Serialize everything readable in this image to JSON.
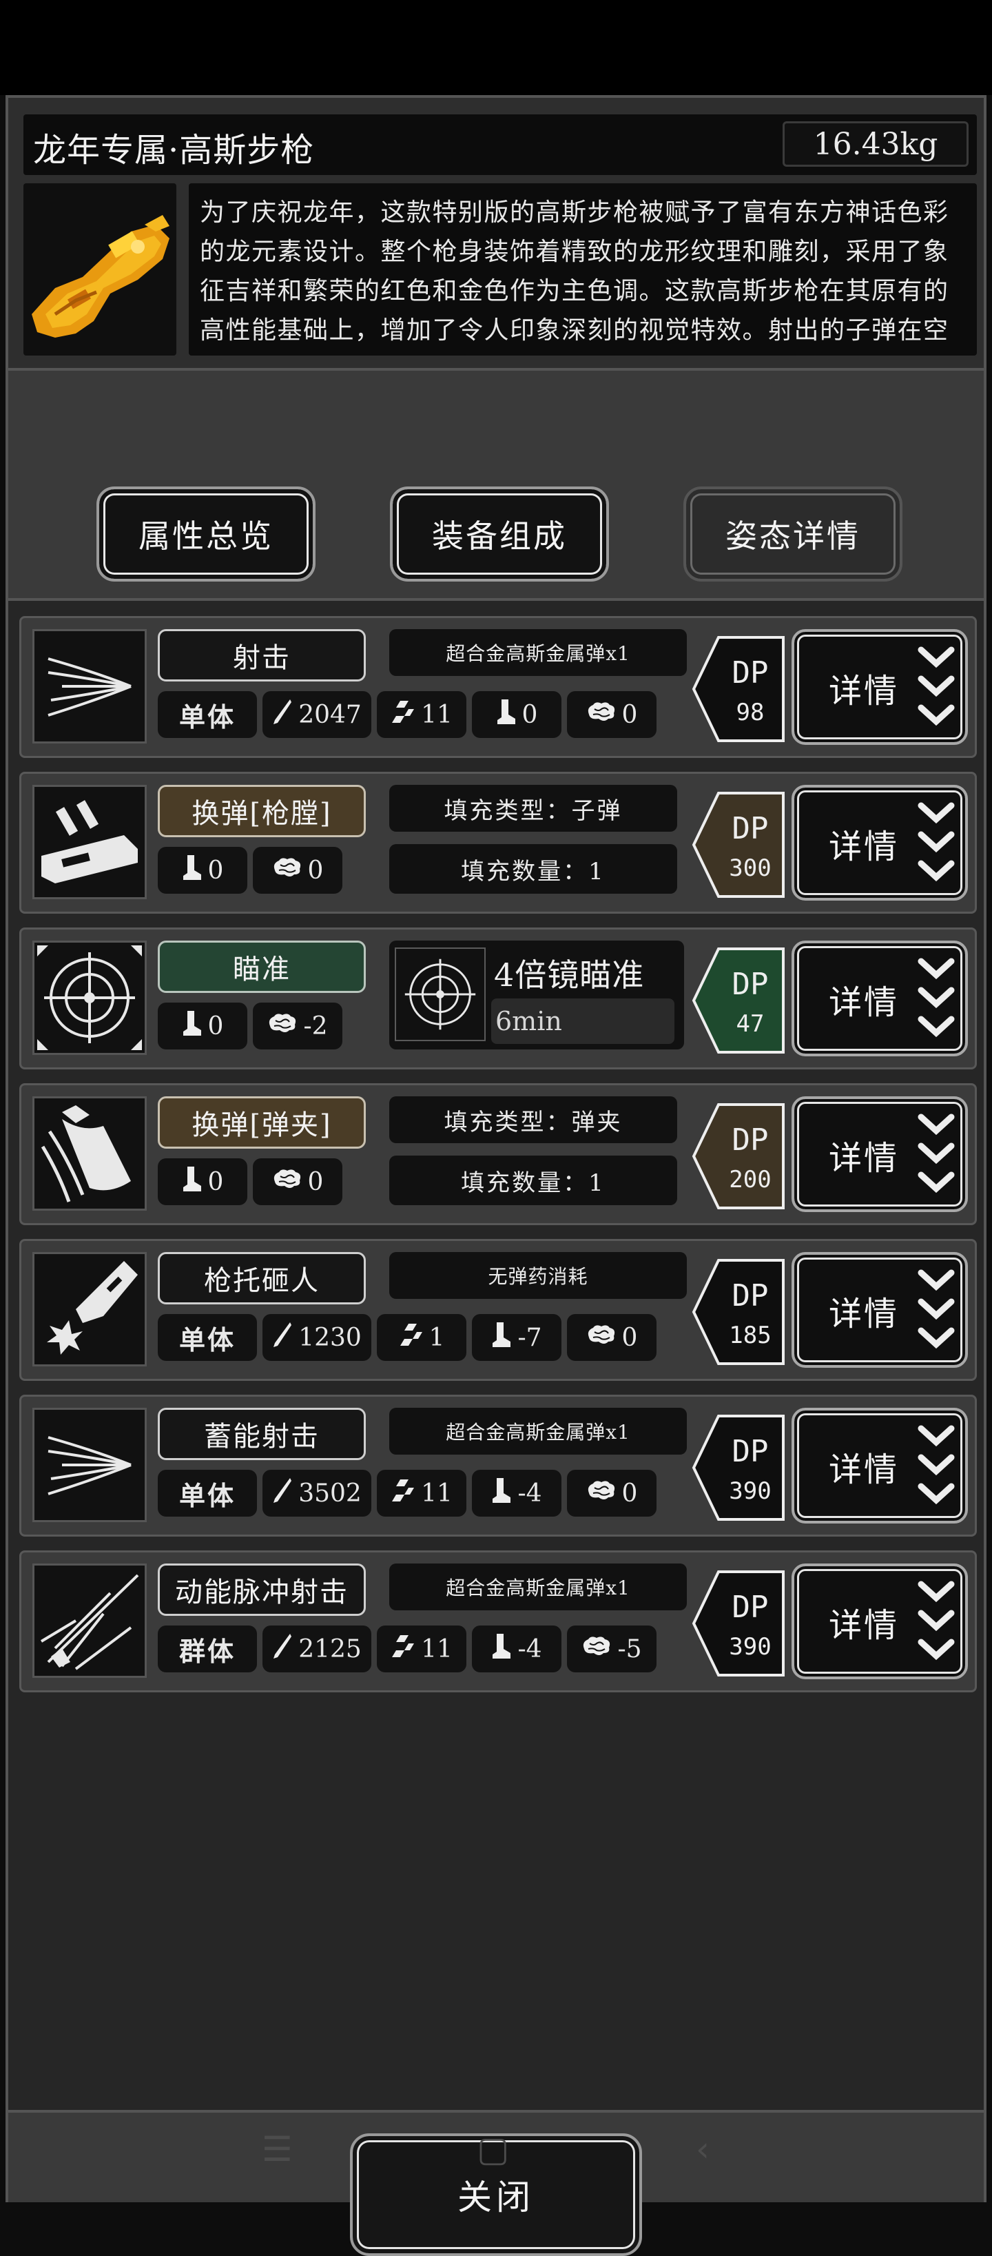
{
  "header": {
    "title": "龙年专属·高斯步枪",
    "weight": "16.43kg",
    "description": "为了庆祝龙年，这款特别版的高斯步枪被赋予了富有东方神话色彩的龙元素设计。整个枪身装饰着精致的龙形纹理和雕刻，采用了象征吉祥和繁荣的红色和金色作为主色调。这款高斯步枪在其原有的高性能基础上，增加了令人印象深刻的视觉特效。射出的子弹在空中飞行时，弹头会呈现金红色的龙头形状，这种独特的视"
  },
  "tabs": [
    {
      "label": "属性总览"
    },
    {
      "label": "装备组成"
    },
    {
      "label": "姿态详情"
    }
  ],
  "detail_label": "详情",
  "skills": [
    {
      "name": "射击",
      "info": "超合金高斯金属弹x1",
      "target": "单体",
      "attack": "2047",
      "speed": "11",
      "move": "0",
      "brain": "0",
      "dp": "98"
    },
    {
      "name": "换弹[枪膛]",
      "info": "填充类型：子弹",
      "fill": "填充数量：1",
      "move": "0",
      "brain": "0",
      "dp": "300"
    },
    {
      "name": "瞄准",
      "scope_title": "4倍镜瞄准",
      "scope_time": "6min",
      "move": "0",
      "brain": "-2",
      "dp": "47"
    },
    {
      "name": "换弹[弹夹]",
      "info": "填充类型：弹夹",
      "fill": "填充数量：1",
      "move": "0",
      "brain": "0",
      "dp": "200"
    },
    {
      "name": "枪托砸人",
      "info": "无弹药消耗",
      "target": "单体",
      "attack": "1230",
      "speed": "1",
      "move": "-7",
      "brain": "0",
      "dp": "185"
    },
    {
      "name": "蓄能射击",
      "info": "超合金高斯金属弹x1",
      "target": "单体",
      "attack": "3502",
      "speed": "11",
      "move": "-4",
      "brain": "0",
      "dp": "390"
    },
    {
      "name": "动能脉冲射击",
      "info": "超合金高斯金属弹x1",
      "target": "群体",
      "attack": "2125",
      "speed": "11",
      "move": "-4",
      "brain": "-5",
      "dp": "390"
    }
  ],
  "close_label": "关闭",
  "colors": {
    "reload_bg": "#4a3c26",
    "aim_bg": "#244533",
    "dp_dark": "#0e0e0e",
    "dp_brown": "#3e3424",
    "dp_green": "#1e4a2e"
  }
}
